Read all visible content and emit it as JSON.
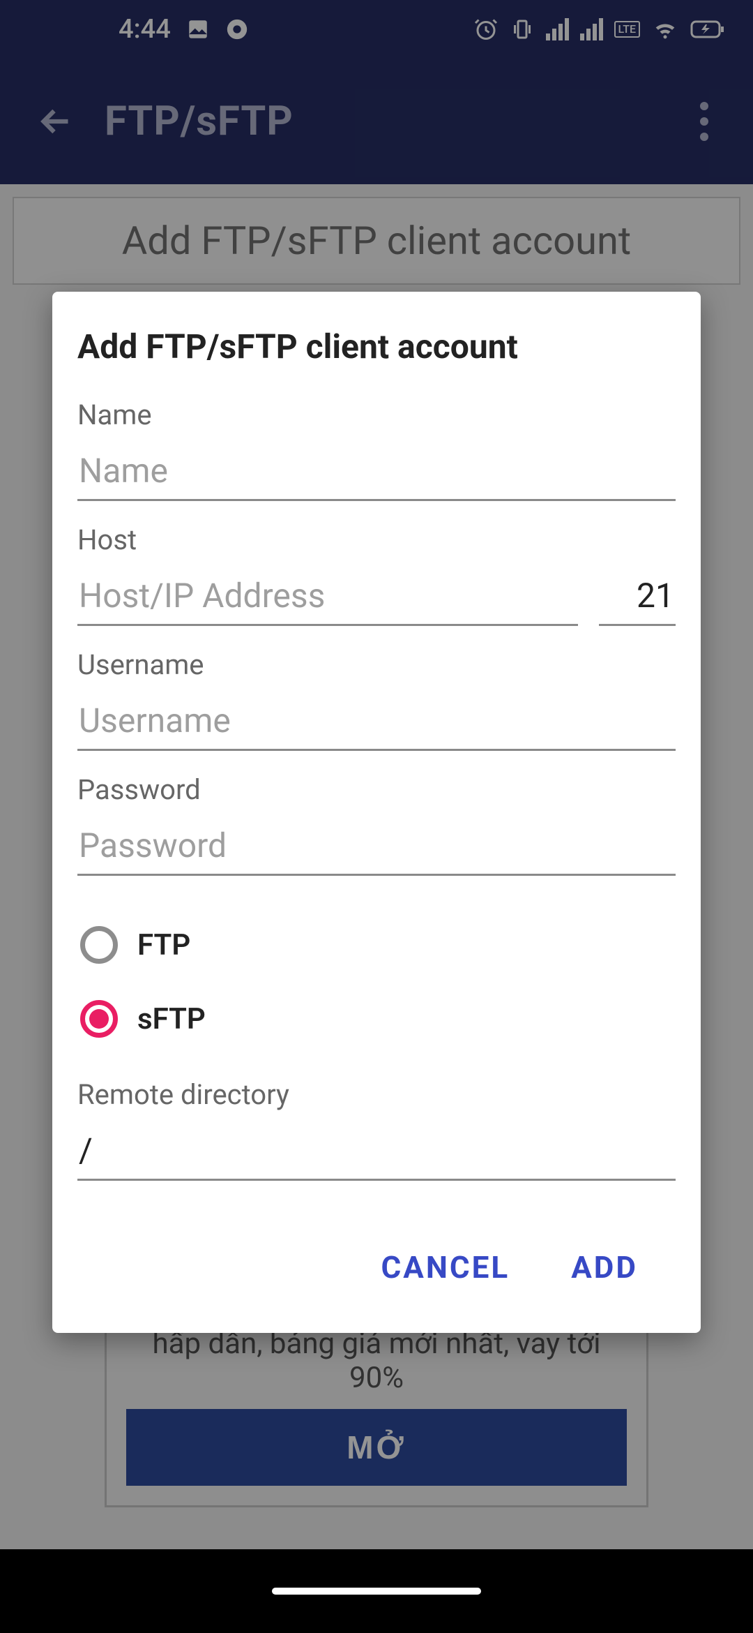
{
  "statusbar": {
    "time": "4:44"
  },
  "appbar": {
    "title": "FTP/sFTP"
  },
  "background": {
    "add_card_title": "Add FTP/sFTP client account",
    "ad_text": "hấp dẫn, bảng giá mới nhất, vay tới 90%",
    "ad_button": "MỞ"
  },
  "dialog": {
    "title": "Add FTP/sFTP client account",
    "labels": {
      "name": "Name",
      "host": "Host",
      "username": "Username",
      "password": "Password",
      "remote_dir": "Remote directory"
    },
    "placeholders": {
      "name": "Name",
      "host": "Host/IP Address",
      "username": "Username",
      "password": "Password"
    },
    "values": {
      "name": "",
      "host": "",
      "port": "21",
      "username": "",
      "password": "",
      "remote_dir": "/"
    },
    "radio": {
      "ftp": "FTP",
      "sftp": "sFTP",
      "selected": "sftp"
    },
    "actions": {
      "cancel": "CANCEL",
      "add": "ADD"
    }
  }
}
